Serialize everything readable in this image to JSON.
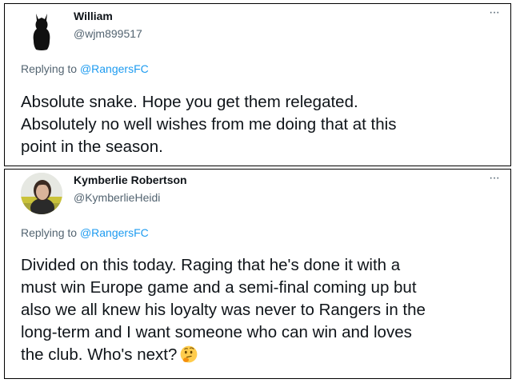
{
  "tweets": [
    {
      "display_name": "William",
      "handle": "@wjm899517",
      "more_icon": "···",
      "reply_prefix": "Replying to",
      "reply_to": "@RangersFC",
      "text_lines": [
        "Absolute snake.  Hope you get them relegated.",
        "Absolutely no well wishes from me doing that at this",
        "point in the season."
      ]
    },
    {
      "display_name": "Kymberlie Robertson",
      "handle": "@KymberlieHeidi",
      "more_icon": "···",
      "reply_prefix": "Replying to",
      "reply_to": "@RangersFC",
      "text_lines": [
        "Divided on this today. Raging that he's done it with a",
        "must win Europe game and a semi-final coming up but",
        "also we all knew his loyalty was never to Rangers in the",
        "long-term and I want someone who can win and loves",
        "the club. Who's next?"
      ],
      "emoji": "thinking-face-icon"
    }
  ],
  "colors": {
    "text": "#0f1419",
    "secondary": "#536471",
    "link": "#1d9bf0",
    "border": "#000000"
  }
}
